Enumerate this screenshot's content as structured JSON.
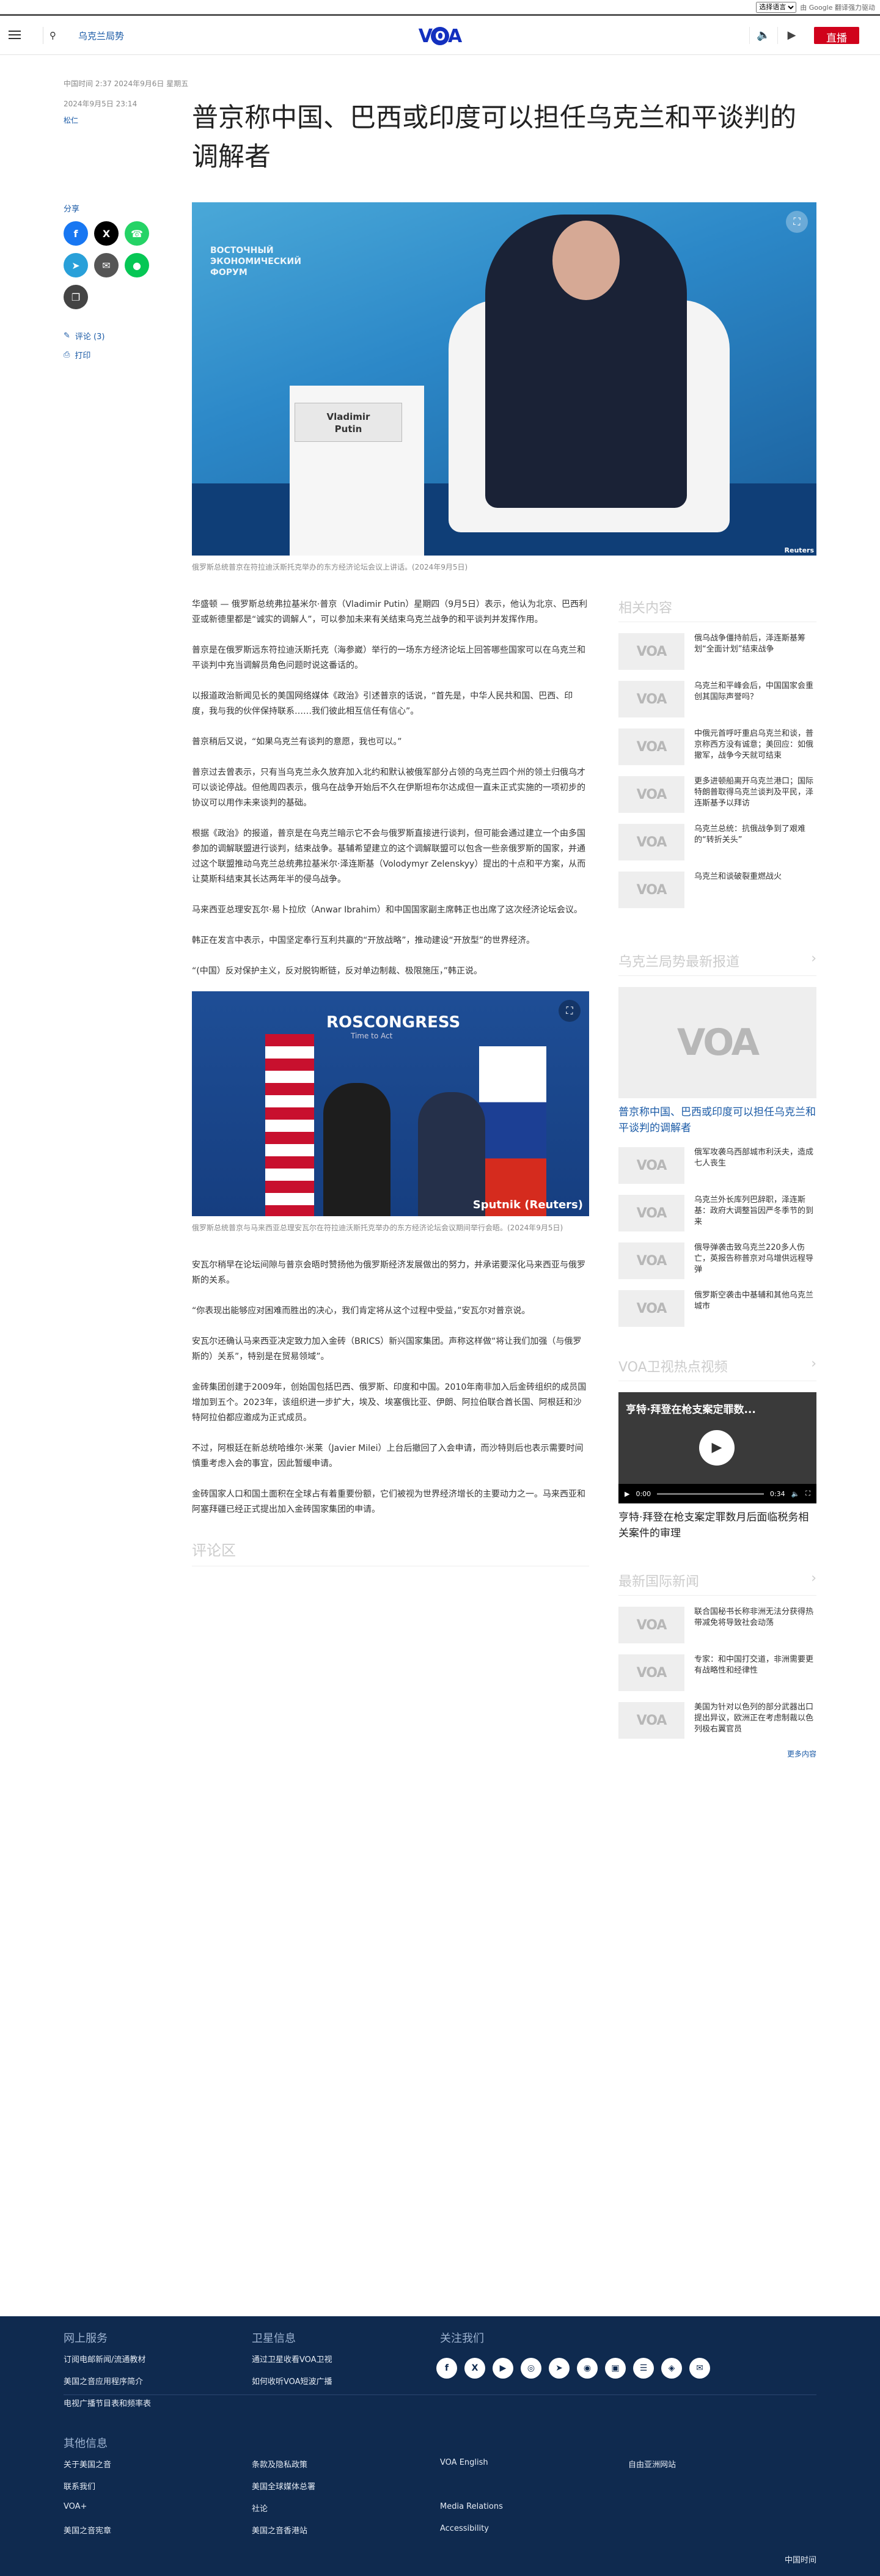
{
  "topbar": {
    "lang_select": "选择语言",
    "gt_text": "由 Google 翻译强力驱动"
  },
  "header": {
    "section": "乌克兰局势",
    "logo": "VOA",
    "live": "直播"
  },
  "article": {
    "dateline": "中国时间 2:37 2024年9月6日 星期五",
    "date": "2024年9月5日 23:14",
    "author": "松仁",
    "title": "普京称中国、巴西或印度可以担任乌克兰和平谈判的调解者",
    "share": "分享",
    "comments_link": "评论 (3)",
    "print_link": "打印",
    "hero_plate_1": "Vladimir",
    "hero_plate_2": "Putin",
    "hero_credit": "Reuters",
    "hero_caption": "俄罗斯总统普京在符拉迪沃斯托克举办的东方经济论坛会议上讲话。(2024年9月5日)",
    "paragraphs": [
      "华盛顿 — 俄罗斯总统弗拉基米尔·普京（Vladimir Putin）星期四（9月5日）表示，他认为北京、巴西利亚或新德里都是“诚实的调解人”，可以参加未来有关结束乌克兰战争的和平谈判并发挥作用。",
      "普京是在俄罗斯远东符拉迪沃斯托克（海参崴）举行的一场东方经济论坛上回答哪些国家可以在乌克兰和平谈判中充当调解员角色问题时说这番话的。",
      "以报道政治新闻见长的美国网络媒体《政治》引述普京的话说，“首先是，中华人民共和国、巴西、印度，我与我的伙伴保持联系……我们彼此相互信任有信心”。",
      "普京稍后又说，“如果乌克兰有谈判的意愿，我也可以。”",
      "普京过去曾表示，只有当乌克兰永久放弃加入北约和默认被俄军部分占领的乌克兰四个州的领土归俄乌才可以谈论停战。但他周四表示，俄乌在战争开始后不久在伊斯坦布尔达成但一直未正式实施的一项初步的协议可以用作未来谈判的基础。",
      "根据《政治》的报道，普京是在乌克兰暗示它不会与俄罗斯直接进行谈判，但可能会通过建立一个由多国参加的调解联盟进行谈判，结束战争。基辅希望建立的这个调解联盟可以包含一些亲俄罗斯的国家，并通过这个联盟推动乌克兰总统弗拉基米尔·泽连斯基（Volodymyr Zelenskyy）提出的十点和平方案，从而让莫斯科结束其长达两年半的侵乌战争。",
      "马来西亚总理安瓦尔·易卜拉欣（Anwar Ibrahim）和中国国家副主席韩正也出席了这次经济论坛会议。",
      "韩正在发言中表示，中国坚定奉行互利共赢的“开放战略”，推动建设“开放型”的世界经济。",
      "“(中国）反对保护主义，反对脱钩断链，反对单边制裁、极限施压，”韩正说。"
    ],
    "img2_text": "ROSCONGRESS",
    "img2_sub": "Time to Act",
    "img2_credit": "Sputnik (Reuters)",
    "img2_caption": "俄罗斯总统普京与马来西亚总理安瓦尔在符拉迪沃斯托克举办的东方经济论坛会议期间举行会晤。(2024年9月5日)",
    "paragraphs2": [
      "安瓦尔稍早在论坛间隙与普京会晤时赞扬他为俄罗斯经济发展做出的努力，并承诺要深化马来西亚与俄罗斯的关系。",
      "“你表现出能够应对困难而胜出的决心，我们肯定将从这个过程中受益，”安瓦尔对普京说。",
      "安瓦尔还确认马来西亚决定致力加入金砖（BRICS）新兴国家集团。声称这样做“将让我们加强（与俄罗斯的）关系”，特别是在贸易领域”。",
      "金砖集团创建于2009年，创始国包括巴西、俄罗斯、印度和中国。2010年南非加入后金砖组织的成员国增加到五个。2023年，该组织进一步扩大，埃及、埃塞俄比亚、伊朗、阿拉伯联合酋长国、阿根廷和沙特阿拉伯都应邀成为正式成员。",
      "不过，阿根廷在新总统哈维尔·米莱（Javier Milei）上台后撤回了入会申请，而沙特则后也表示需要时间慎重考虑入会的事宜，因此暂缓申请。",
      "金砖国家人口和国土面积在全球占有着重要份额，它们被视为世界经济增长的主要动力之一。马来西亚和阿塞拜疆已经正式提出加入金砖国家集团的申请。"
    ],
    "comments_heading": "评论区"
  },
  "sidebar": {
    "related_h": "相关内容",
    "related": [
      "俄乌战争僵持前后，泽连斯基筹划“全面计划”结束战争",
      "乌克兰和平峰会后，中国国家会重创其国际声誉吗？",
      "中俄元首呼吁重启乌克兰和谈，普京称西方没有诚意；美回应：如俄撤军，战争今天就可结束",
      "更多进顿船离开乌克兰港口；国际特朗普取得乌克兰谈判及平民，泽连斯基予以拜访",
      "乌克兰总统：抗俄战争到了艰难的“转折关头”",
      "乌克兰和谈破裂重燃战火"
    ],
    "latest_h": "乌克兰局势最新报道",
    "latest_big": "普京称中国、巴西或印度可以担任乌克兰和平谈判的调解者",
    "latest": [
      "俄军攻袭乌西部城市利沃夫，造成七人丧生",
      "乌克兰外长库列巴辞职，泽连斯基：政府大调整旨因严冬季节的到来",
      "俄导弹袭击致乌克兰220多人伤亡，英报告称普京对乌增供远程导弹",
      "俄罗斯空袭击中基辅和其他乌克兰城市"
    ],
    "video_h": "VOA卫视热点视频",
    "video_overlay": "亨特·拜登在枪支案定罪数...",
    "video_time_start": "0:00",
    "video_time_end": "0:34",
    "video_title": "亨特·拜登在枪支案定罪数月后面临税务相关案件的审理",
    "intl_h": "最新国际新闻",
    "intl": [
      "联合国秘书长称非洲无法分获得热带减免将导致社会动荡",
      "专家：和中国打交道，非洲需要更有战略性和经律性",
      "美国为针对以色列的部分武器出口提出异议，欧洲正在考虑制裁以色列极右翼官员"
    ],
    "more": "更多内容"
  },
  "footer": {
    "col1_h": "网上服务",
    "col1": [
      "订阅电邮新闻/流通教材",
      "美国之音应用程序简介",
      "电视广播节目表和频率表"
    ],
    "col2_h": "卫星信息",
    "col2": [
      "通过卫星收看VOA卫视",
      "如何收听VOA短波广播"
    ],
    "col3_h": "关注我们",
    "social": [
      "f",
      "X",
      "▶",
      "◎",
      "➤",
      "◉",
      "▣",
      "☰",
      "◈",
      "✉"
    ],
    "other_h": "其他信息",
    "other_a": [
      "关于美国之音",
      "联系我们",
      "VOA+",
      "美国之音宪章"
    ],
    "other_b": [
      "条款及隐私政策",
      "美国全球媒体总署",
      "社论",
      "美国之音香港站"
    ],
    "other_c": [
      "VOA English",
      "",
      "Media Relations",
      "Accessibility"
    ],
    "other_d": [
      "自由亚洲网站"
    ],
    "lang": "中国时间"
  }
}
